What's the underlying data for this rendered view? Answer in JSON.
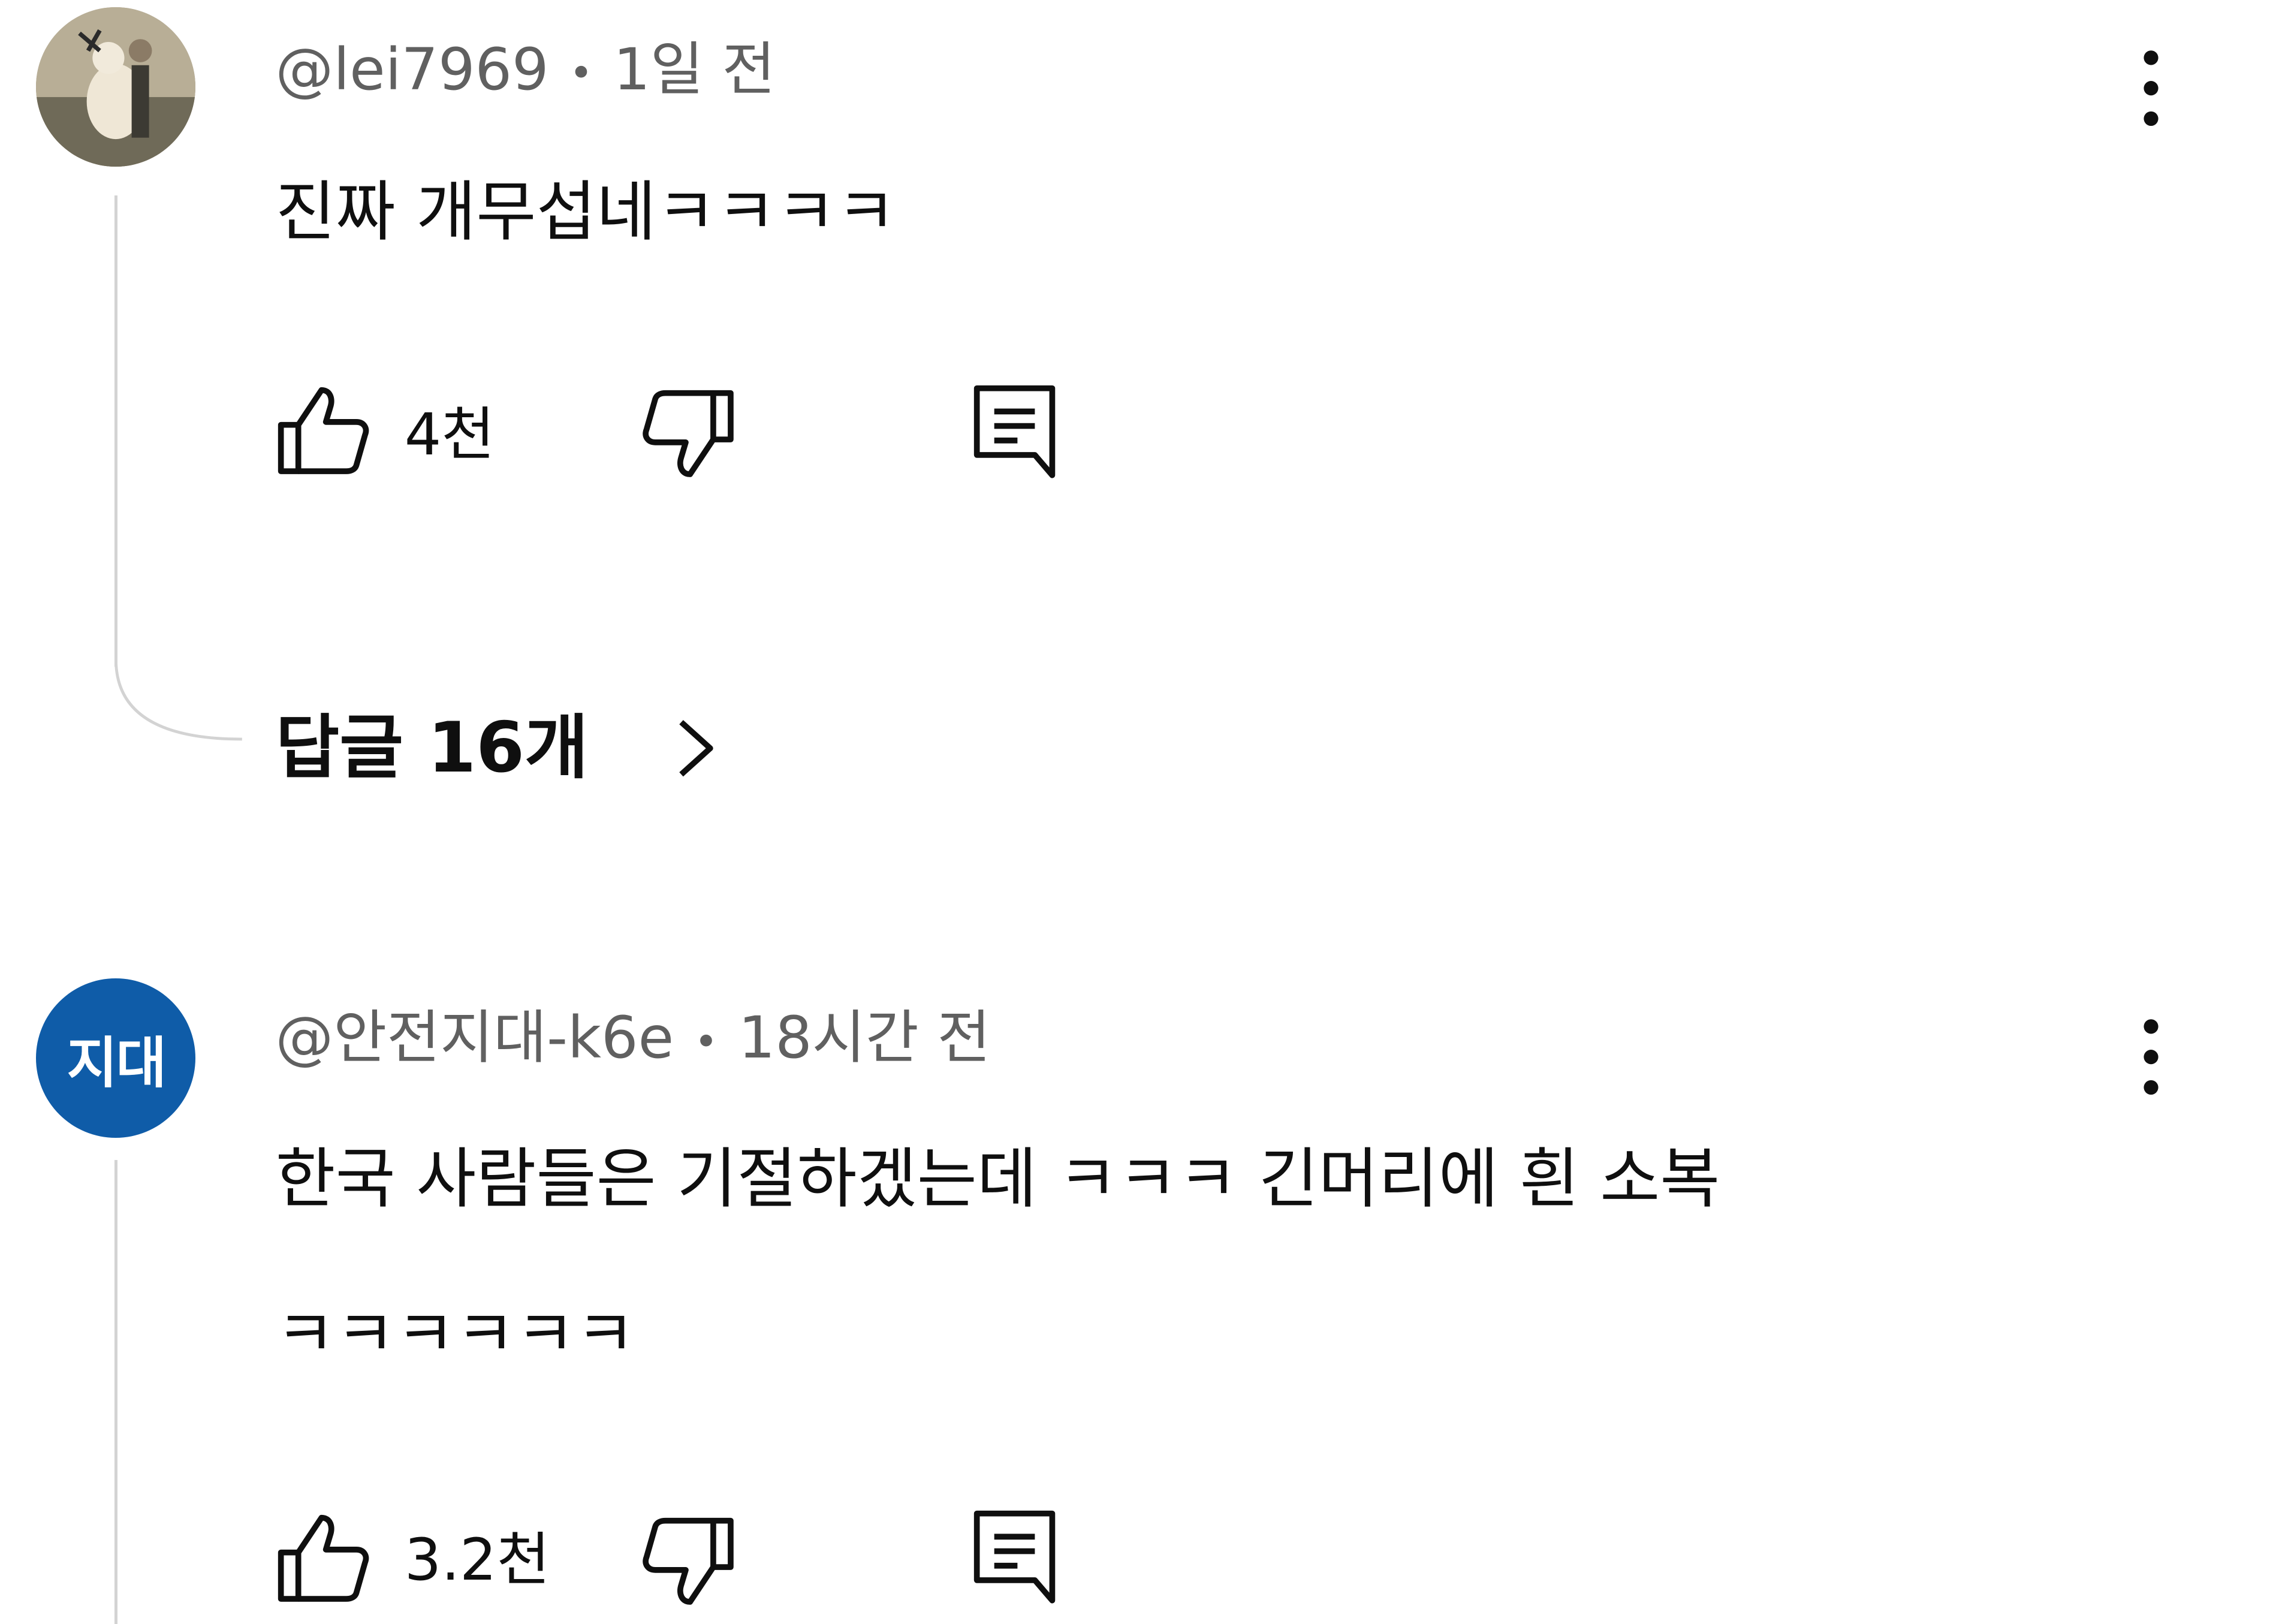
{
  "comments": [
    {
      "author": "@lei7969",
      "separator": "•",
      "time": "1일 전",
      "text": "진짜 개무섭네ㅋㅋㅋㅋ",
      "likes": "4천",
      "replies_label": "답글 16개",
      "avatar": {
        "type": "photo",
        "icon": "user-photo-avatar"
      }
    },
    {
      "author": "@안전지대-k6e",
      "separator": "•",
      "time": "18시간 전",
      "text_line1": "한국 사람들은 기절하겠는데 ㅋㅋㅋ 긴머리에 흰 소복",
      "text_line2": "ㅋㅋㅋㅋㅋㅋ",
      "likes": "3.2천",
      "avatar": {
        "type": "initials",
        "initials": "지대",
        "color": "#0f5ca8"
      }
    }
  ],
  "icons": [
    "like-icon",
    "dislike-icon",
    "reply-icon",
    "more-options-icon",
    "chevron-right-icon"
  ]
}
